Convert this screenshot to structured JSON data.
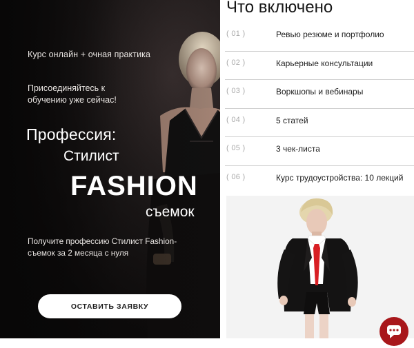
{
  "hero": {
    "course_type": "Курс онлайн + очная практика",
    "join_text": "Присоединяйтесь к обучению уже сейчас!",
    "profession_label": "Профессия:",
    "profession_line1": "Стилист",
    "profession_line2": "FASHION",
    "profession_line3": "съемок",
    "get_profession": "Получите профессию Стилист Fashion-съемок за 2 месяца с нуля",
    "cta_label": "ОСТАВИТЬ ЗАЯВКУ"
  },
  "included": {
    "title": "Что включено",
    "items": [
      {
        "num": "( 01 )",
        "label": "Ревью резюме и портфолио"
      },
      {
        "num": "( 02 )",
        "label": "Карьерные консультации"
      },
      {
        "num": "( 03 )",
        "label": "Воркшопы и вебинары"
      },
      {
        "num": "( 04 )",
        "label": "5 статей"
      },
      {
        "num": "( 05 )",
        "label": "3 чек-листа"
      },
      {
        "num": "( 06 )",
        "label": "Курс трудоустройства: 10 лекций"
      }
    ]
  },
  "icons": {
    "chat": "chat-bubble-icon"
  },
  "colors": {
    "hero_bg": "#0d0b0b",
    "chat_accent": "#a8171b",
    "tie_red": "#d81f24"
  }
}
